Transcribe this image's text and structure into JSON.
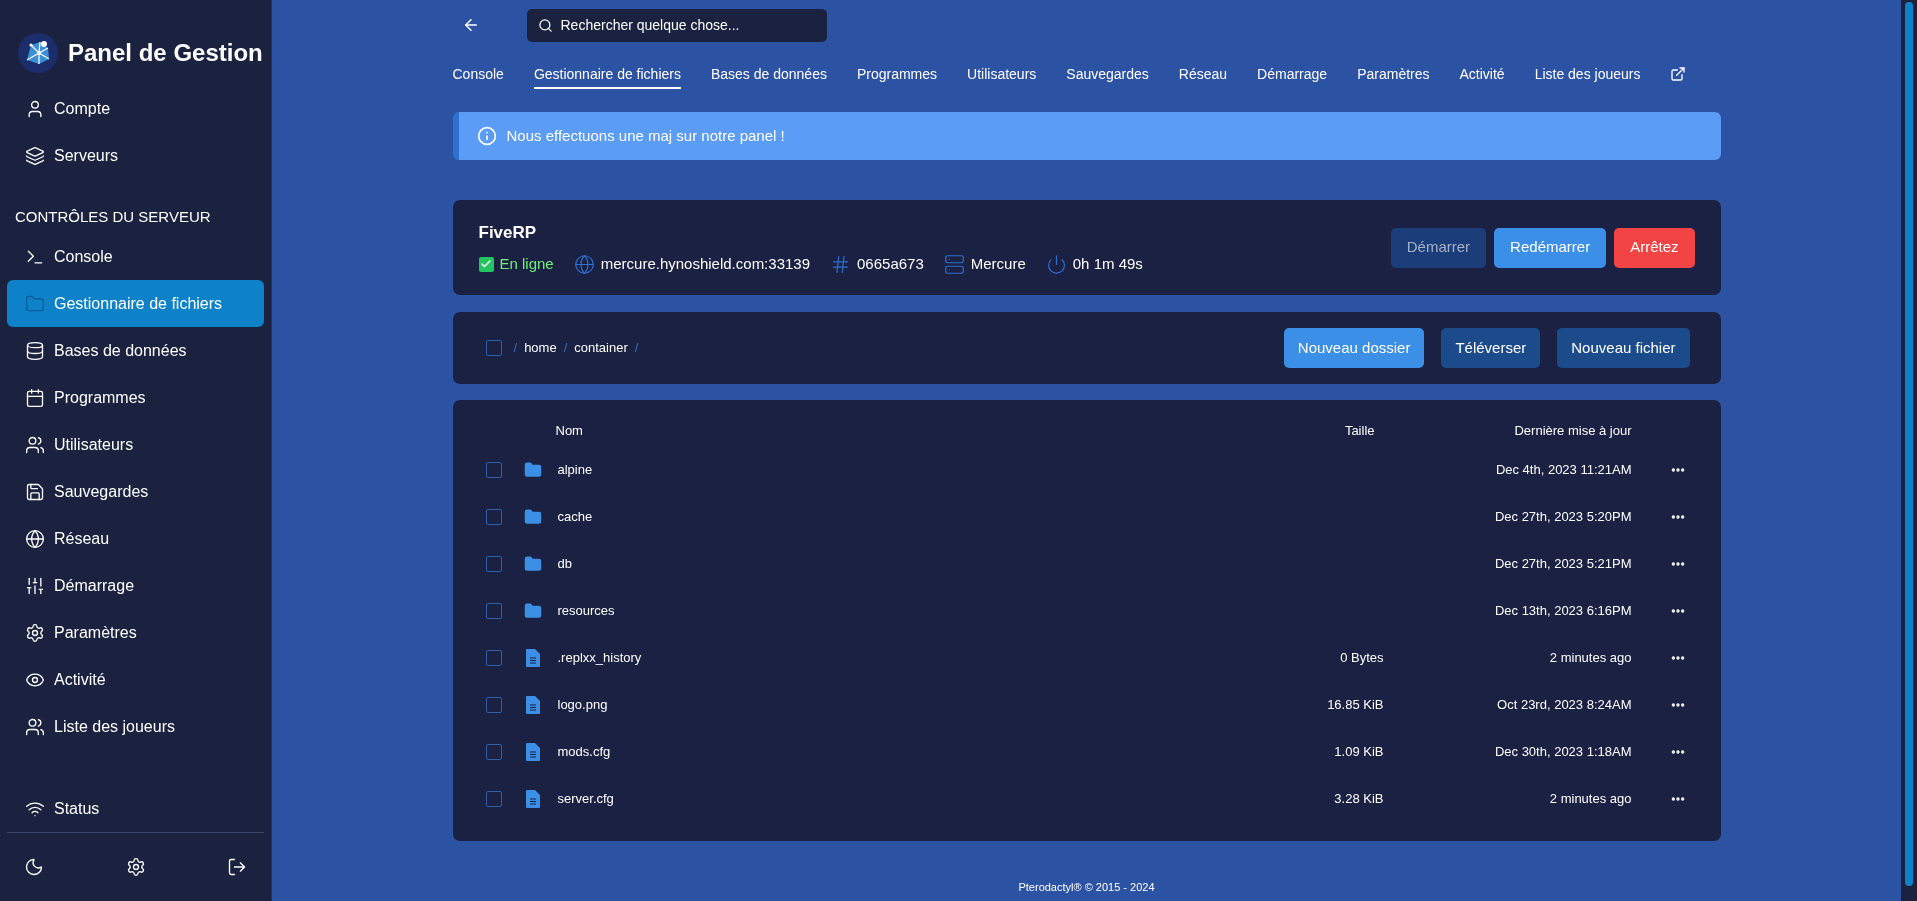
{
  "sidebar": {
    "brand": "Panel de Gestion",
    "top_items": [
      {
        "label": "Compte",
        "selected": false
      },
      {
        "label": "Serveurs",
        "selected": false
      }
    ],
    "section_header": "CONTRÔLES DU SERVEUR",
    "items": [
      {
        "label": "Console",
        "selected": false
      },
      {
        "label": "Gestionnaire de fichiers",
        "selected": true
      },
      {
        "label": "Bases de données",
        "selected": false
      },
      {
        "label": "Programmes",
        "selected": false
      },
      {
        "label": "Utilisateurs",
        "selected": false
      },
      {
        "label": "Sauvegardes",
        "selected": false
      },
      {
        "label": "Réseau",
        "selected": false
      },
      {
        "label": "Démarrage",
        "selected": false
      },
      {
        "label": "Paramètres",
        "selected": false
      },
      {
        "label": "Activité",
        "selected": false
      },
      {
        "label": "Liste des joueurs",
        "selected": false
      }
    ],
    "status": "Status"
  },
  "search": {
    "placeholder": "Rechercher quelque chose..."
  },
  "tabs": [
    {
      "label": "Console",
      "selected": false
    },
    {
      "label": "Gestionnaire de fichiers",
      "selected": true
    },
    {
      "label": "Bases de données",
      "selected": false
    },
    {
      "label": "Programmes",
      "selected": false
    },
    {
      "label": "Utilisateurs",
      "selected": false
    },
    {
      "label": "Sauvegardes",
      "selected": false
    },
    {
      "label": "Réseau",
      "selected": false
    },
    {
      "label": "Démarrage",
      "selected": false
    },
    {
      "label": "Paramètres",
      "selected": false
    },
    {
      "label": "Activité",
      "selected": false
    },
    {
      "label": "Liste des joueurs",
      "selected": false
    }
  ],
  "alert": "Nous effectuons une maj sur notre panel !",
  "server": {
    "name": "FiveRP",
    "online": true,
    "status": "En ligne",
    "address": "mercure.hynoshield.com:33139",
    "id": "0665a673",
    "node": "Mercure",
    "uptime": "0h 1m 49s",
    "buttons": [
      {
        "label": "Démarrer",
        "kind": "start",
        "disabled": true
      },
      {
        "label": "Redémarrer",
        "kind": "restart",
        "disabled": false
      },
      {
        "label": "Arrêtez",
        "kind": "stop",
        "disabled": false
      }
    ]
  },
  "file_manager": {
    "select_all": {
      "checked": false
    },
    "separator": "/",
    "breadcrumb": [
      "home",
      "container"
    ],
    "buttons": [
      {
        "label": "Nouveau dossier",
        "kind": "primary"
      },
      {
        "label": "Téléverser",
        "kind": "secondary"
      },
      {
        "label": "Nouveau fichier",
        "kind": "secondary"
      }
    ]
  },
  "table": {
    "columns": [
      "Nom",
      "Taille",
      "Dernière mise à jour"
    ],
    "rows": [
      {
        "kind": "folder",
        "name": "alpine",
        "modified": "Dec 4th, 2023 11:21AM",
        "checked": false
      },
      {
        "kind": "folder",
        "name": "cache",
        "modified": "Dec 27th, 2023 5:20PM",
        "checked": false
      },
      {
        "kind": "folder",
        "name": "db",
        "modified": "Dec 27th, 2023 5:21PM",
        "checked": false
      },
      {
        "kind": "folder",
        "name": "resources",
        "modified": "Dec 13th, 2023 6:16PM",
        "checked": false
      },
      {
        "kind": "file",
        "name": ".replxx_history",
        "size": "0 Bytes",
        "modified": "2 minutes ago",
        "checked": false
      },
      {
        "kind": "file",
        "name": "logo.png",
        "size": "16.85 KiB",
        "modified": "Oct 23rd, 2023 8:24AM",
        "checked": false
      },
      {
        "kind": "file",
        "name": "mods.cfg",
        "size": "1.09 KiB",
        "modified": "Dec 30th, 2023 1:18AM",
        "checked": false
      },
      {
        "kind": "file",
        "name": "server.cfg",
        "size": "3.28 KiB",
        "modified": "2 minutes ago",
        "checked": false
      }
    ]
  },
  "footer": "Pterodactyl® © 2015 - 2024"
}
